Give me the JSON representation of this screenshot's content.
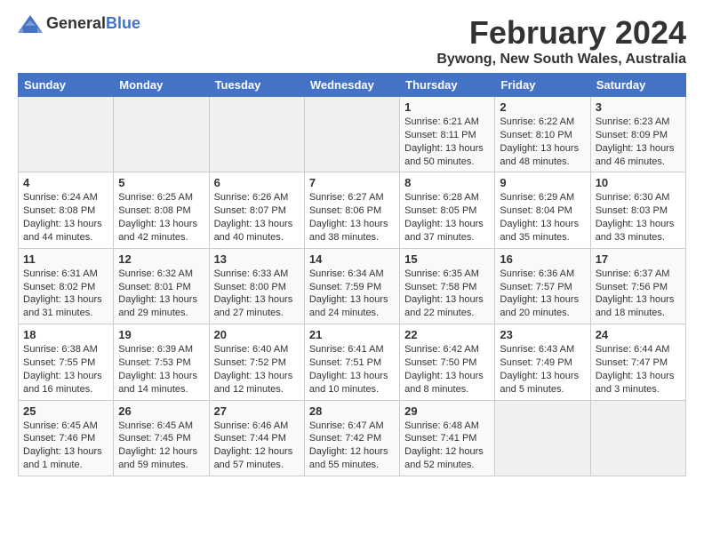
{
  "header": {
    "logo_general": "General",
    "logo_blue": "Blue",
    "month_title": "February 2024",
    "location": "Bywong, New South Wales, Australia"
  },
  "weekdays": [
    "Sunday",
    "Monday",
    "Tuesday",
    "Wednesday",
    "Thursday",
    "Friday",
    "Saturday"
  ],
  "weeks": [
    [
      {
        "day": "",
        "empty": true
      },
      {
        "day": "",
        "empty": true
      },
      {
        "day": "",
        "empty": true
      },
      {
        "day": "",
        "empty": true
      },
      {
        "day": "1",
        "sunrise": "6:21 AM",
        "sunset": "8:11 PM",
        "daylight": "13 hours and 50 minutes."
      },
      {
        "day": "2",
        "sunrise": "6:22 AM",
        "sunset": "8:10 PM",
        "daylight": "13 hours and 48 minutes."
      },
      {
        "day": "3",
        "sunrise": "6:23 AM",
        "sunset": "8:09 PM",
        "daylight": "13 hours and 46 minutes."
      }
    ],
    [
      {
        "day": "4",
        "sunrise": "6:24 AM",
        "sunset": "8:08 PM",
        "daylight": "13 hours and 44 minutes."
      },
      {
        "day": "5",
        "sunrise": "6:25 AM",
        "sunset": "8:08 PM",
        "daylight": "13 hours and 42 minutes."
      },
      {
        "day": "6",
        "sunrise": "6:26 AM",
        "sunset": "8:07 PM",
        "daylight": "13 hours and 40 minutes."
      },
      {
        "day": "7",
        "sunrise": "6:27 AM",
        "sunset": "8:06 PM",
        "daylight": "13 hours and 38 minutes."
      },
      {
        "day": "8",
        "sunrise": "6:28 AM",
        "sunset": "8:05 PM",
        "daylight": "13 hours and 37 minutes."
      },
      {
        "day": "9",
        "sunrise": "6:29 AM",
        "sunset": "8:04 PM",
        "daylight": "13 hours and 35 minutes."
      },
      {
        "day": "10",
        "sunrise": "6:30 AM",
        "sunset": "8:03 PM",
        "daylight": "13 hours and 33 minutes."
      }
    ],
    [
      {
        "day": "11",
        "sunrise": "6:31 AM",
        "sunset": "8:02 PM",
        "daylight": "13 hours and 31 minutes."
      },
      {
        "day": "12",
        "sunrise": "6:32 AM",
        "sunset": "8:01 PM",
        "daylight": "13 hours and 29 minutes."
      },
      {
        "day": "13",
        "sunrise": "6:33 AM",
        "sunset": "8:00 PM",
        "daylight": "13 hours and 27 minutes."
      },
      {
        "day": "14",
        "sunrise": "6:34 AM",
        "sunset": "7:59 PM",
        "daylight": "13 hours and 24 minutes."
      },
      {
        "day": "15",
        "sunrise": "6:35 AM",
        "sunset": "7:58 PM",
        "daylight": "13 hours and 22 minutes."
      },
      {
        "day": "16",
        "sunrise": "6:36 AM",
        "sunset": "7:57 PM",
        "daylight": "13 hours and 20 minutes."
      },
      {
        "day": "17",
        "sunrise": "6:37 AM",
        "sunset": "7:56 PM",
        "daylight": "13 hours and 18 minutes."
      }
    ],
    [
      {
        "day": "18",
        "sunrise": "6:38 AM",
        "sunset": "7:55 PM",
        "daylight": "13 hours and 16 minutes."
      },
      {
        "day": "19",
        "sunrise": "6:39 AM",
        "sunset": "7:53 PM",
        "daylight": "13 hours and 14 minutes."
      },
      {
        "day": "20",
        "sunrise": "6:40 AM",
        "sunset": "7:52 PM",
        "daylight": "13 hours and 12 minutes."
      },
      {
        "day": "21",
        "sunrise": "6:41 AM",
        "sunset": "7:51 PM",
        "daylight": "13 hours and 10 minutes."
      },
      {
        "day": "22",
        "sunrise": "6:42 AM",
        "sunset": "7:50 PM",
        "daylight": "13 hours and 8 minutes."
      },
      {
        "day": "23",
        "sunrise": "6:43 AM",
        "sunset": "7:49 PM",
        "daylight": "13 hours and 5 minutes."
      },
      {
        "day": "24",
        "sunrise": "6:44 AM",
        "sunset": "7:47 PM",
        "daylight": "13 hours and 3 minutes."
      }
    ],
    [
      {
        "day": "25",
        "sunrise": "6:45 AM",
        "sunset": "7:46 PM",
        "daylight": "13 hours and 1 minute."
      },
      {
        "day": "26",
        "sunrise": "6:45 AM",
        "sunset": "7:45 PM",
        "daylight": "12 hours and 59 minutes."
      },
      {
        "day": "27",
        "sunrise": "6:46 AM",
        "sunset": "7:44 PM",
        "daylight": "12 hours and 57 minutes."
      },
      {
        "day": "28",
        "sunrise": "6:47 AM",
        "sunset": "7:42 PM",
        "daylight": "12 hours and 55 minutes."
      },
      {
        "day": "29",
        "sunrise": "6:48 AM",
        "sunset": "7:41 PM",
        "daylight": "12 hours and 52 minutes."
      },
      {
        "day": "",
        "empty": true
      },
      {
        "day": "",
        "empty": true
      }
    ]
  ],
  "labels": {
    "sunrise_prefix": "Sunrise: ",
    "sunset_prefix": "Sunset: ",
    "daylight_prefix": "Daylight: "
  }
}
